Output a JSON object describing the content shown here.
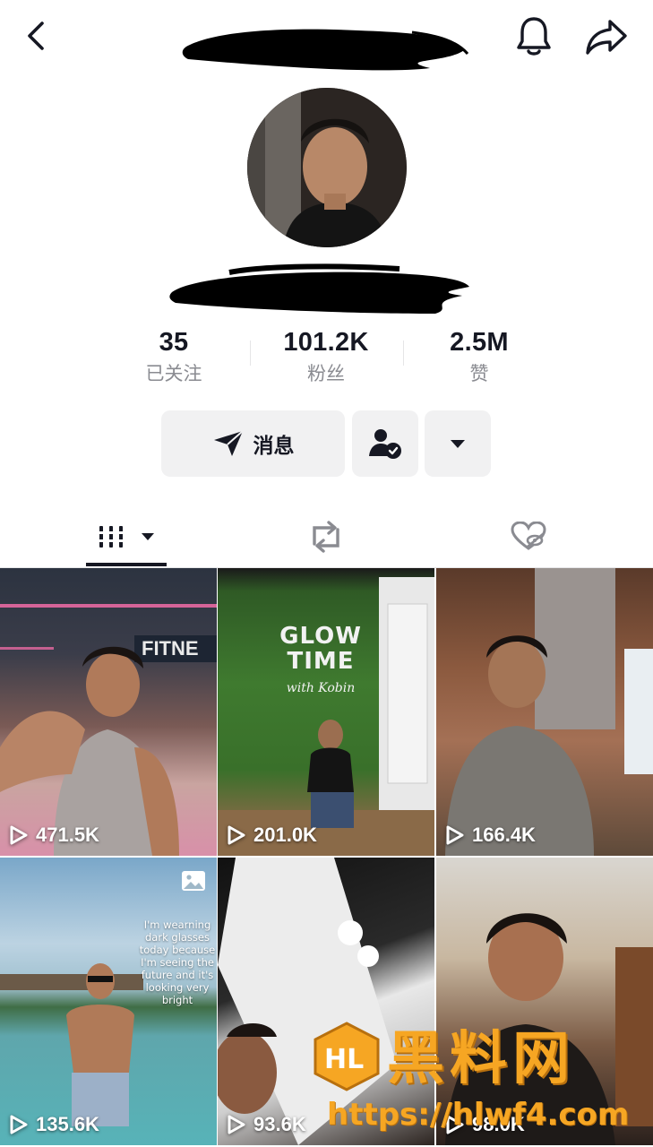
{
  "stats": [
    {
      "value": "35",
      "label": "已关注"
    },
    {
      "value": "101.2K",
      "label": "粉丝"
    },
    {
      "value": "2.5M",
      "label": "赞"
    }
  ],
  "actions": {
    "message_label": "消息"
  },
  "videos": [
    {
      "views": "471.5K"
    },
    {
      "views": "201.0K",
      "overlay": "GLOW TIME",
      "subtitle": "with Kobin"
    },
    {
      "views": "166.4K"
    },
    {
      "views": "135.6K",
      "caption": "I'm wearning dark glasses today because I'm seeing the future and it's looking very bright"
    },
    {
      "views": "93.6K"
    },
    {
      "views": "98.0K"
    }
  ],
  "cell1_sign": "FITNE",
  "watermark": {
    "title": "黑料网",
    "url": "https://hlwf4.com"
  },
  "colors": {
    "accent_text": "#161823",
    "secondary_text": "#8a8b91",
    "button_bg": "#f1f1f2",
    "watermark": "#f6a623"
  },
  "icons": [
    "back-icon",
    "bell-icon",
    "share-icon",
    "send-icon",
    "user-check-icon",
    "chevron-down-icon",
    "grid-icon",
    "repost-icon",
    "heart-hidden-icon",
    "play-icon",
    "photo-icon"
  ]
}
